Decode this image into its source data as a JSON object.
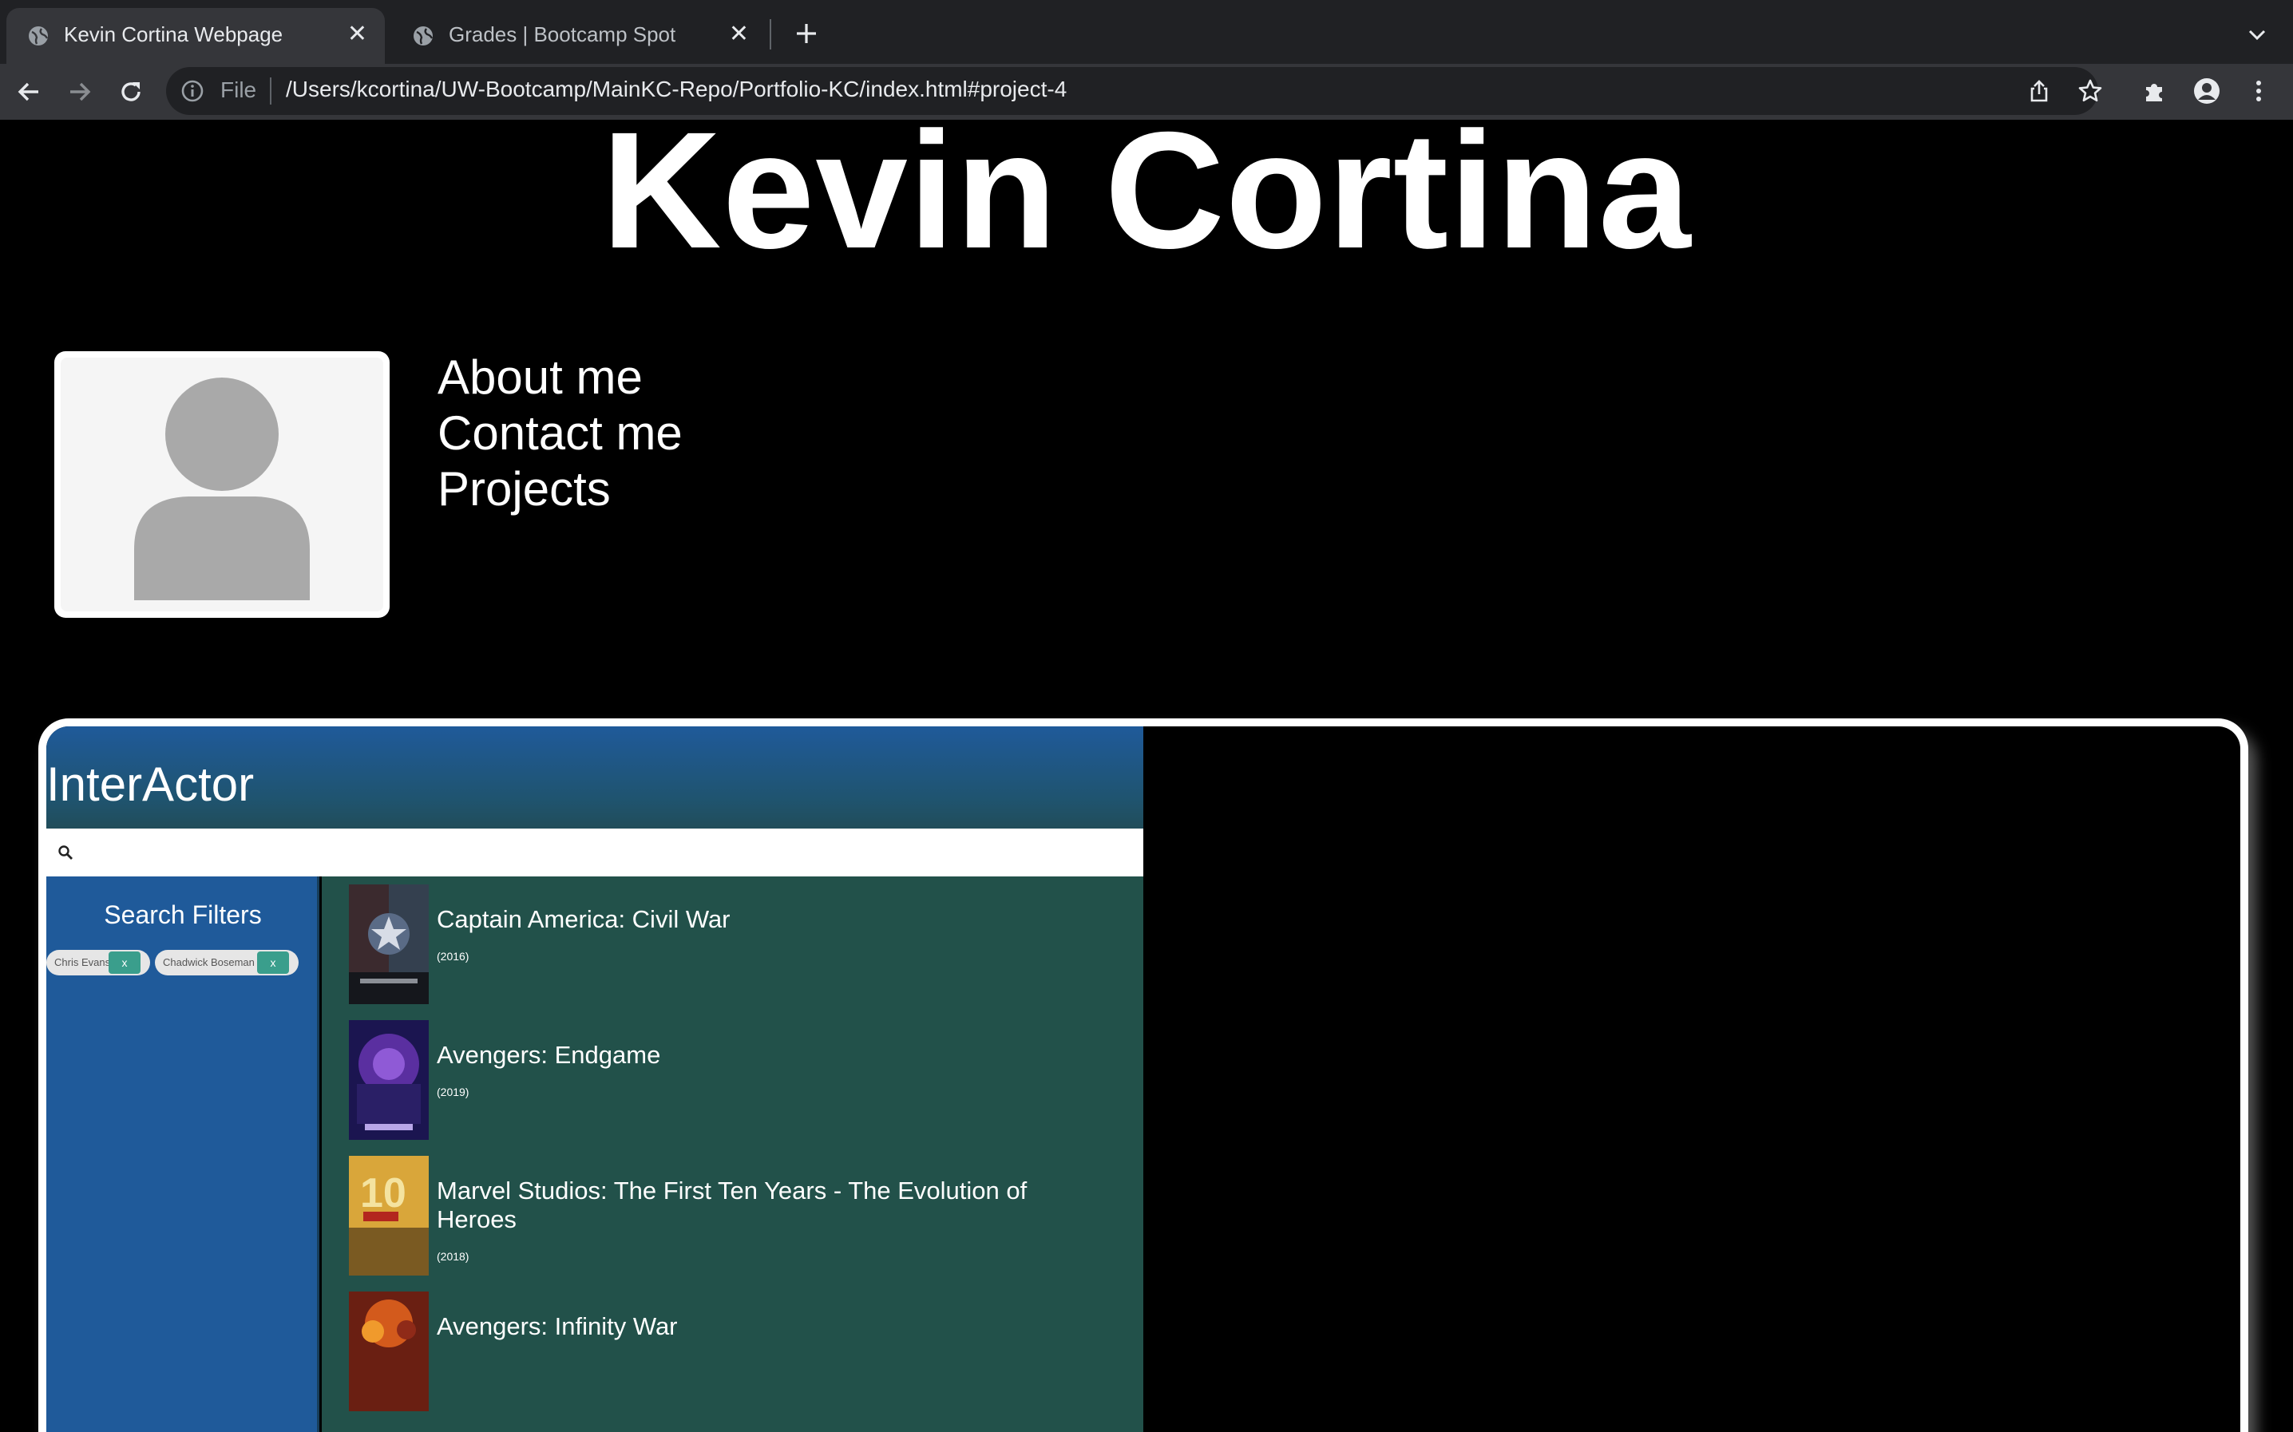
{
  "browser": {
    "tabs": [
      {
        "title": "Kevin Cortina Webpage",
        "active": true
      },
      {
        "title": "Grades | Bootcamp Spot",
        "active": false
      }
    ],
    "omnibox": {
      "scheme_label": "File",
      "url": "/Users/kcortina/UW-Bootcamp/MainKC-Repo/Portfolio-KC/index.html#project-4"
    },
    "icons": [
      "back-icon",
      "forward-icon",
      "reload-icon",
      "info-icon",
      "share-icon",
      "star-icon",
      "extensions-icon",
      "profile-icon",
      "menu-icon",
      "new-tab-icon",
      "tab-search-icon"
    ]
  },
  "page": {
    "title": "Kevin Cortina",
    "nav": [
      "About me",
      "Contact me",
      "Projects"
    ]
  },
  "app": {
    "title": "InterActor",
    "search_placeholder": "",
    "filters": {
      "title": "Search Filters",
      "chips": [
        {
          "label": "Chris Evans",
          "remove": "x"
        },
        {
          "label": "Chadwick Boseman",
          "remove": "x"
        }
      ]
    },
    "results": [
      {
        "title": "Captain America: Civil War",
        "year": "(2016)"
      },
      {
        "title": "Avengers: Endgame",
        "year": "(2019)"
      },
      {
        "title": "Marvel Studios: The First Ten Years - The Evolution of Heroes",
        "year": "(2018)"
      },
      {
        "title": "Avengers: Infinity War",
        "year": ""
      }
    ]
  },
  "colors": {
    "chrome_dark": "#202124",
    "chrome_toolbar": "#35363a",
    "app_blue": "#1f5a9a",
    "app_green": "#22514a",
    "chip_x": "#3a9e8c"
  }
}
